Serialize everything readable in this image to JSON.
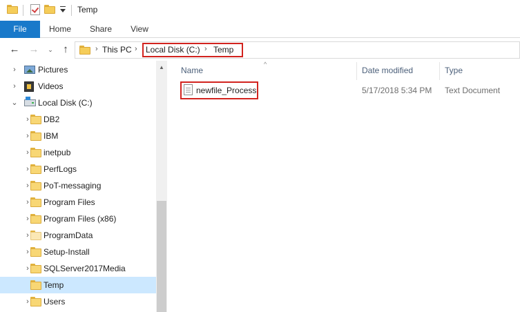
{
  "window": {
    "title": "Temp"
  },
  "ribbon": {
    "tabs": [
      "File",
      "Home",
      "Share",
      "View"
    ]
  },
  "nav_buttons": {
    "back": "←",
    "forward": "→",
    "recent": "⌄",
    "up": "↑"
  },
  "address": {
    "crumbs": [
      "This PC",
      "Local Disk (C:)",
      "Temp"
    ],
    "separator": "›"
  },
  "tree": {
    "chevron_collapsed": "›",
    "chevron_expanded": "⌄",
    "items": [
      {
        "label": "Pictures",
        "icon": "pictures-icon",
        "expanded": false,
        "selected": false
      },
      {
        "label": "Videos",
        "icon": "videos-icon",
        "expanded": false,
        "selected": false
      },
      {
        "label": "Local Disk (C:)",
        "icon": "local-disk-icon",
        "expanded": true,
        "selected": false
      },
      {
        "label": "DB2",
        "icon": "folder-icon",
        "expanded": false,
        "selected": false
      },
      {
        "label": "IBM",
        "icon": "folder-icon",
        "expanded": false,
        "selected": false
      },
      {
        "label": "inetpub",
        "icon": "folder-icon",
        "expanded": false,
        "selected": false
      },
      {
        "label": "PerfLogs",
        "icon": "folder-icon",
        "expanded": false,
        "selected": false
      },
      {
        "label": "PoT-messaging",
        "icon": "folder-icon",
        "expanded": false,
        "selected": false
      },
      {
        "label": "Program Files",
        "icon": "folder-icon",
        "expanded": false,
        "selected": false
      },
      {
        "label": "Program Files (x86)",
        "icon": "folder-icon",
        "expanded": false,
        "selected": false
      },
      {
        "label": "ProgramData",
        "icon": "folder-icon-pale",
        "expanded": false,
        "selected": false
      },
      {
        "label": "Setup-Install",
        "icon": "folder-icon",
        "expanded": false,
        "selected": false
      },
      {
        "label": "SQLServer2017Media",
        "icon": "folder-icon",
        "expanded": false,
        "selected": false
      },
      {
        "label": "Temp",
        "icon": "folder-icon",
        "expanded": false,
        "selected": true
      },
      {
        "label": "Users",
        "icon": "folder-icon",
        "expanded": false,
        "selected": false
      }
    ]
  },
  "file_list": {
    "sort_indicator": "^",
    "columns": {
      "name": "Name",
      "date": "Date modified",
      "type": "Type"
    },
    "rows": [
      {
        "name": "newfile_Process",
        "date_modified": "5/17/2018 5:34 PM",
        "type": "Text Document"
      }
    ]
  },
  "scrollbar": {
    "up_arrow": "▲"
  },
  "colors": {
    "accent": "#1979ca",
    "selection": "#cce8ff",
    "highlight": "#d2231e",
    "folder": "#f8d775"
  }
}
